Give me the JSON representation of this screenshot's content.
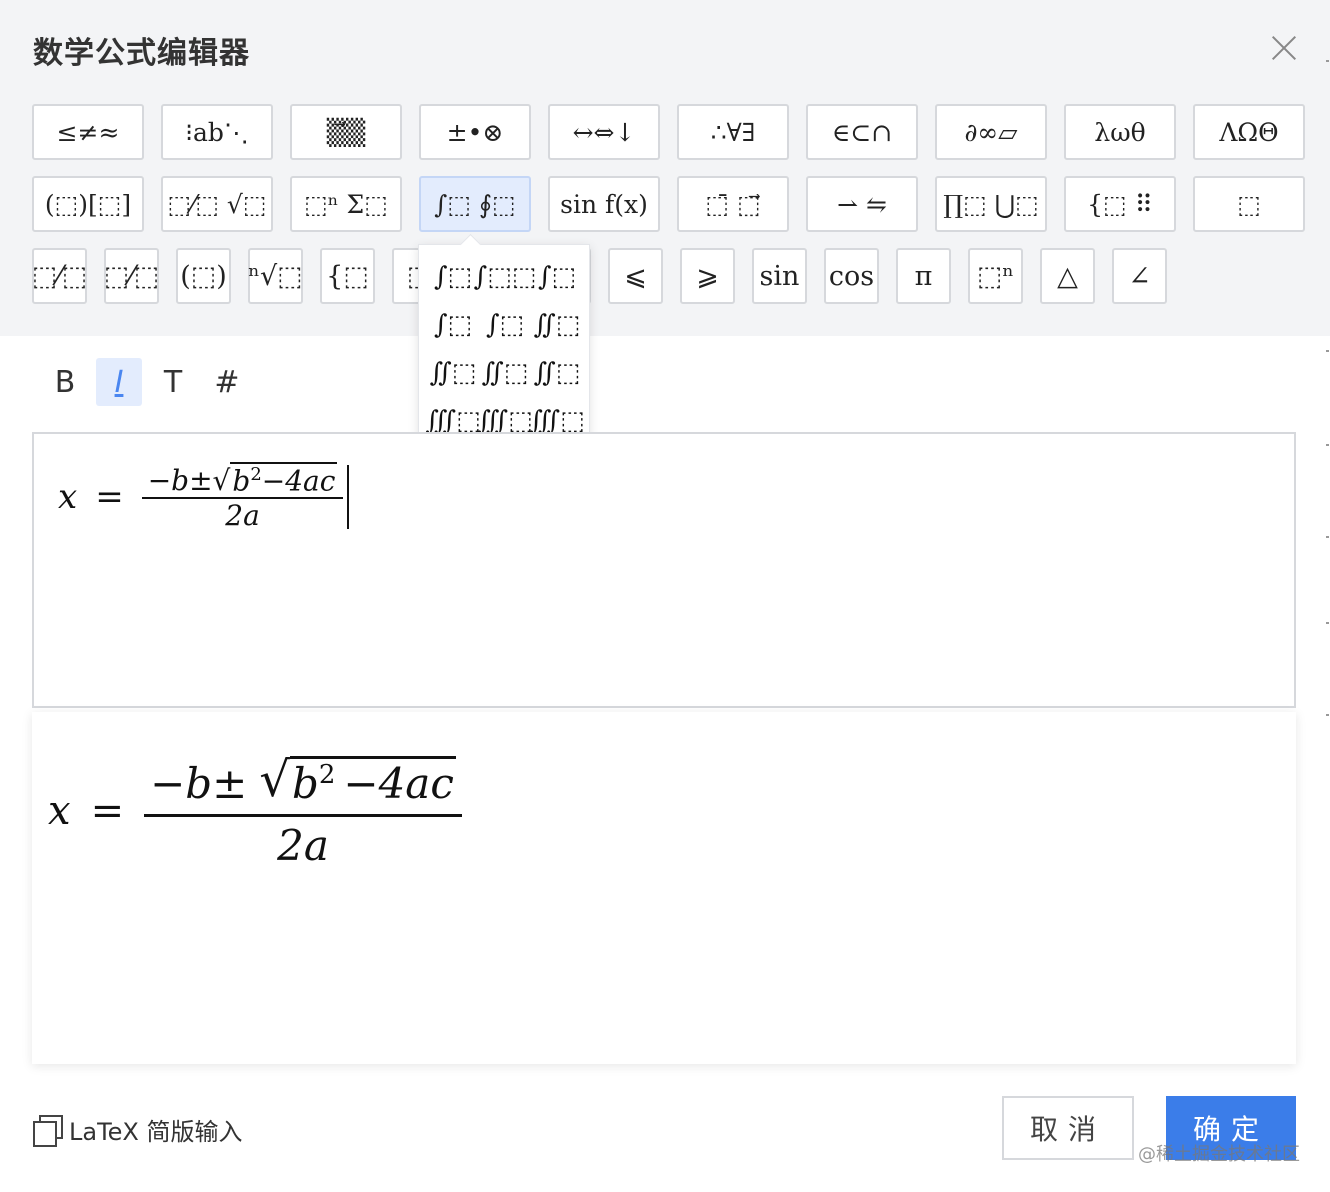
{
  "dialog": {
    "title": "数学公式编辑器"
  },
  "toolbar": {
    "row1": [
      "≤≠≈",
      "⁝ab⋱",
      "▒⃗▒",
      "±•⊗",
      "↔⇔↓",
      "∴∀∃",
      "∈⊂∩",
      "∂∞▱",
      "λωθ",
      "ΛΩΘ"
    ],
    "row2": [
      "(⬚)[⬚]",
      "⬚⁄⬚ √⬚",
      "⬚ⁿ Σ⬚",
      "∫⬚ ∮⬚",
      "sin f(x)",
      "⬚̄ ⬚⃗",
      "⇀ ⇋",
      "∏⬚ ⋃⬚",
      "{⬚ ⠿",
      "⬚"
    ],
    "row3": [
      "⬚⁄⬚",
      "⬚⁄⬚",
      "(⬚)",
      "ⁿ√⬚",
      "{⬚",
      "⬚",
      "",
      "•",
      "⩽",
      "⩾",
      "sin",
      "cos",
      "π",
      "⬚ⁿ",
      "△",
      "∠"
    ]
  },
  "integral_menu": [
    "∫⬚",
    "∫⬚⬚",
    "∫⬚",
    "∫⬚",
    "∫⬚",
    "∬⬚",
    "∬⬚",
    "∬⬚",
    "∬⬚",
    "∭⬚",
    "∭⬚",
    "∭⬚",
    "∭⬚",
    "∮⬚",
    "∮⬚",
    "∮⬚"
  ],
  "format": {
    "bold": "B",
    "italic": "I",
    "text": "T",
    "number": "#"
  },
  "formula": {
    "lhs": "x",
    "eq": "=",
    "num_pre": "−b±",
    "radicand_base": "b",
    "radicand_exp": "2",
    "radicand_rest": "−4ac",
    "den": "2a"
  },
  "footer": {
    "latex_label": "LaTeX 简版输入",
    "cancel_label": "取消",
    "ok_label": "确定",
    "watermark": "@稀土掘金技术社区"
  }
}
